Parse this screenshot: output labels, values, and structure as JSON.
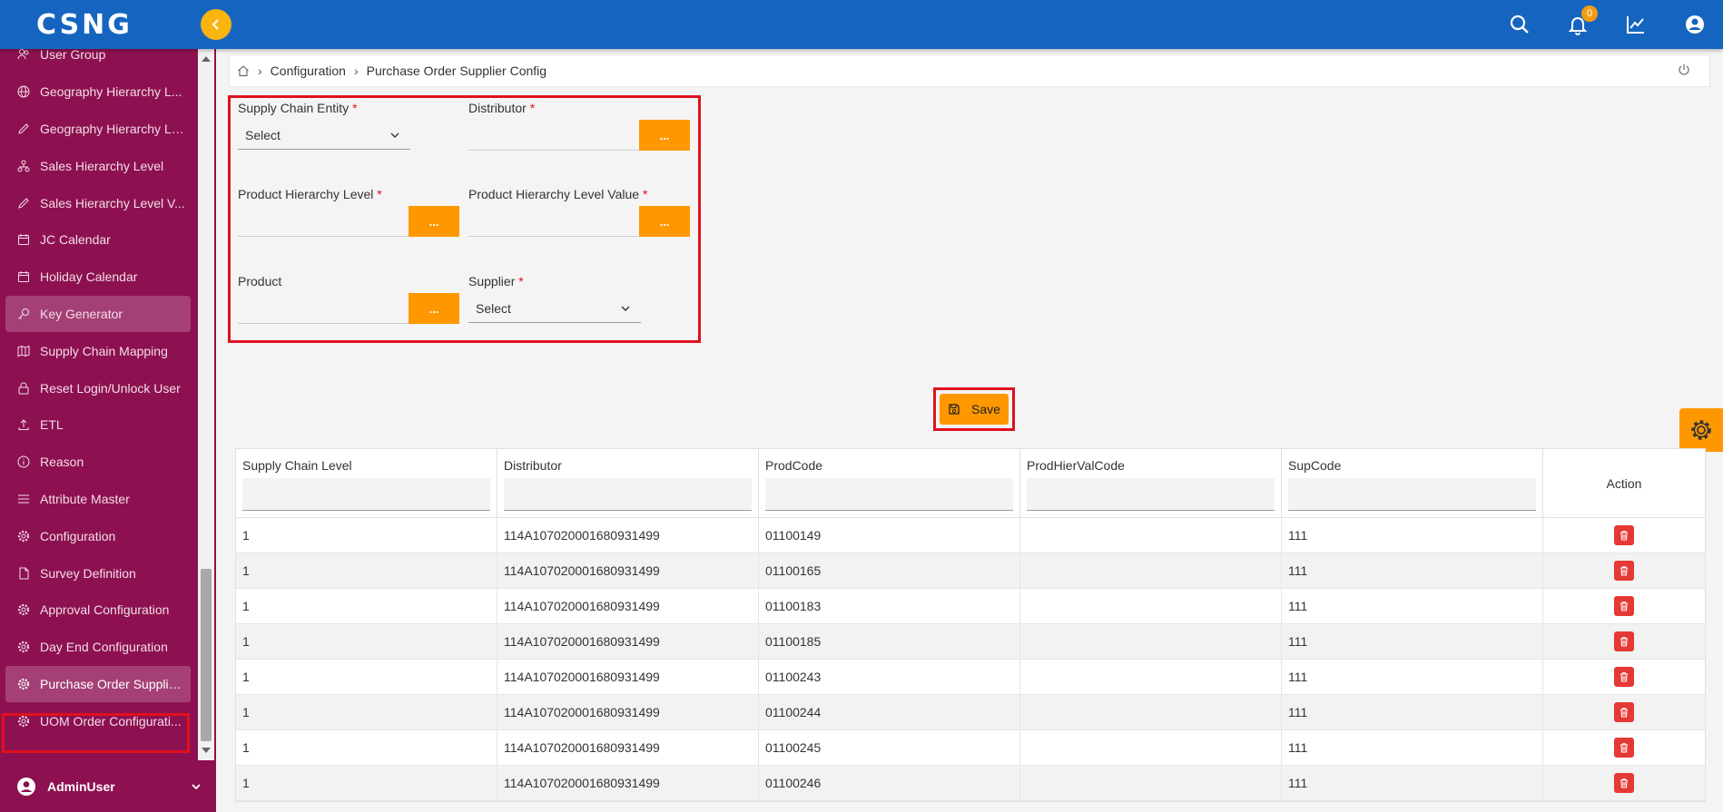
{
  "app": {
    "logo": "CSNG",
    "notification_count": "0"
  },
  "sidebar": {
    "items": [
      {
        "label": "User Group",
        "icon": "user-group-icon"
      },
      {
        "label": "Geography Hierarchy L...",
        "icon": "globe-icon"
      },
      {
        "label": "Geography Hierarchy Le...",
        "icon": "pencil-icon"
      },
      {
        "label": "Sales Hierarchy Level",
        "icon": "hierarchy-icon"
      },
      {
        "label": "Sales Hierarchy Level V...",
        "icon": "pencil-icon"
      },
      {
        "label": "JC Calendar",
        "icon": "calendar-icon"
      },
      {
        "label": "Holiday Calendar",
        "icon": "calendar-icon"
      },
      {
        "label": "Key Generator",
        "icon": "key-icon"
      },
      {
        "label": "Supply Chain Mapping",
        "icon": "map-icon"
      },
      {
        "label": "Reset Login/Unlock User",
        "icon": "lock-icon"
      },
      {
        "label": "ETL",
        "icon": "upload-icon"
      },
      {
        "label": "Reason",
        "icon": "info-icon"
      },
      {
        "label": "Attribute Master",
        "icon": "list-icon"
      },
      {
        "label": "Configuration",
        "icon": "gear-icon"
      },
      {
        "label": "Survey Definition",
        "icon": "document-icon"
      },
      {
        "label": "Approval Configuration",
        "icon": "gear-icon"
      },
      {
        "label": "Day End Configuration",
        "icon": "gear-icon"
      },
      {
        "label": "Purchase Order Supplie...",
        "icon": "gear-icon"
      },
      {
        "label": "UOM Order Configurati...",
        "icon": "gear-icon"
      }
    ],
    "user_name": "AdminUser"
  },
  "breadcrumb": {
    "level1": "Configuration",
    "level2": "Purchase Order Supplier Config"
  },
  "form": {
    "supply_chain_entity": {
      "label": "Supply Chain Entity",
      "value": "Select"
    },
    "distributor": {
      "label": "Distributor",
      "button": "..."
    },
    "product_hierarchy_level": {
      "label": "Product Hierarchy Level",
      "button": "..."
    },
    "product_hierarchy_level_value": {
      "label": "Product Hierarchy Level Value",
      "button": "..."
    },
    "product": {
      "label": "Product",
      "button": "..."
    },
    "supplier": {
      "label": "Supplier",
      "value": "Select"
    },
    "required_mark": "*"
  },
  "save_label": "Save",
  "table": {
    "columns": [
      "Supply Chain Level",
      "Distributor",
      "ProdCode",
      "ProdHierValCode",
      "SupCode",
      "Action"
    ],
    "rows": [
      [
        "1",
        "114A107020001680931499",
        "01100149",
        "",
        "111"
      ],
      [
        "1",
        "114A107020001680931499",
        "01100165",
        "",
        "111"
      ],
      [
        "1",
        "114A107020001680931499",
        "01100183",
        "",
        "111"
      ],
      [
        "1",
        "114A107020001680931499",
        "01100185",
        "",
        "111"
      ],
      [
        "1",
        "114A107020001680931499",
        "01100243",
        "",
        "111"
      ],
      [
        "1",
        "114A107020001680931499",
        "01100244",
        "",
        "111"
      ],
      [
        "1",
        "114A107020001680931499",
        "01100245",
        "",
        "111"
      ],
      [
        "1",
        "114A107020001680931499",
        "01100246",
        "",
        "111"
      ]
    ]
  },
  "colors": {
    "topbar": "#1565c0",
    "sidebar": "#8d1150",
    "accent": "#ff9800",
    "highlight": "#e0101e",
    "delete": "#e53935"
  }
}
